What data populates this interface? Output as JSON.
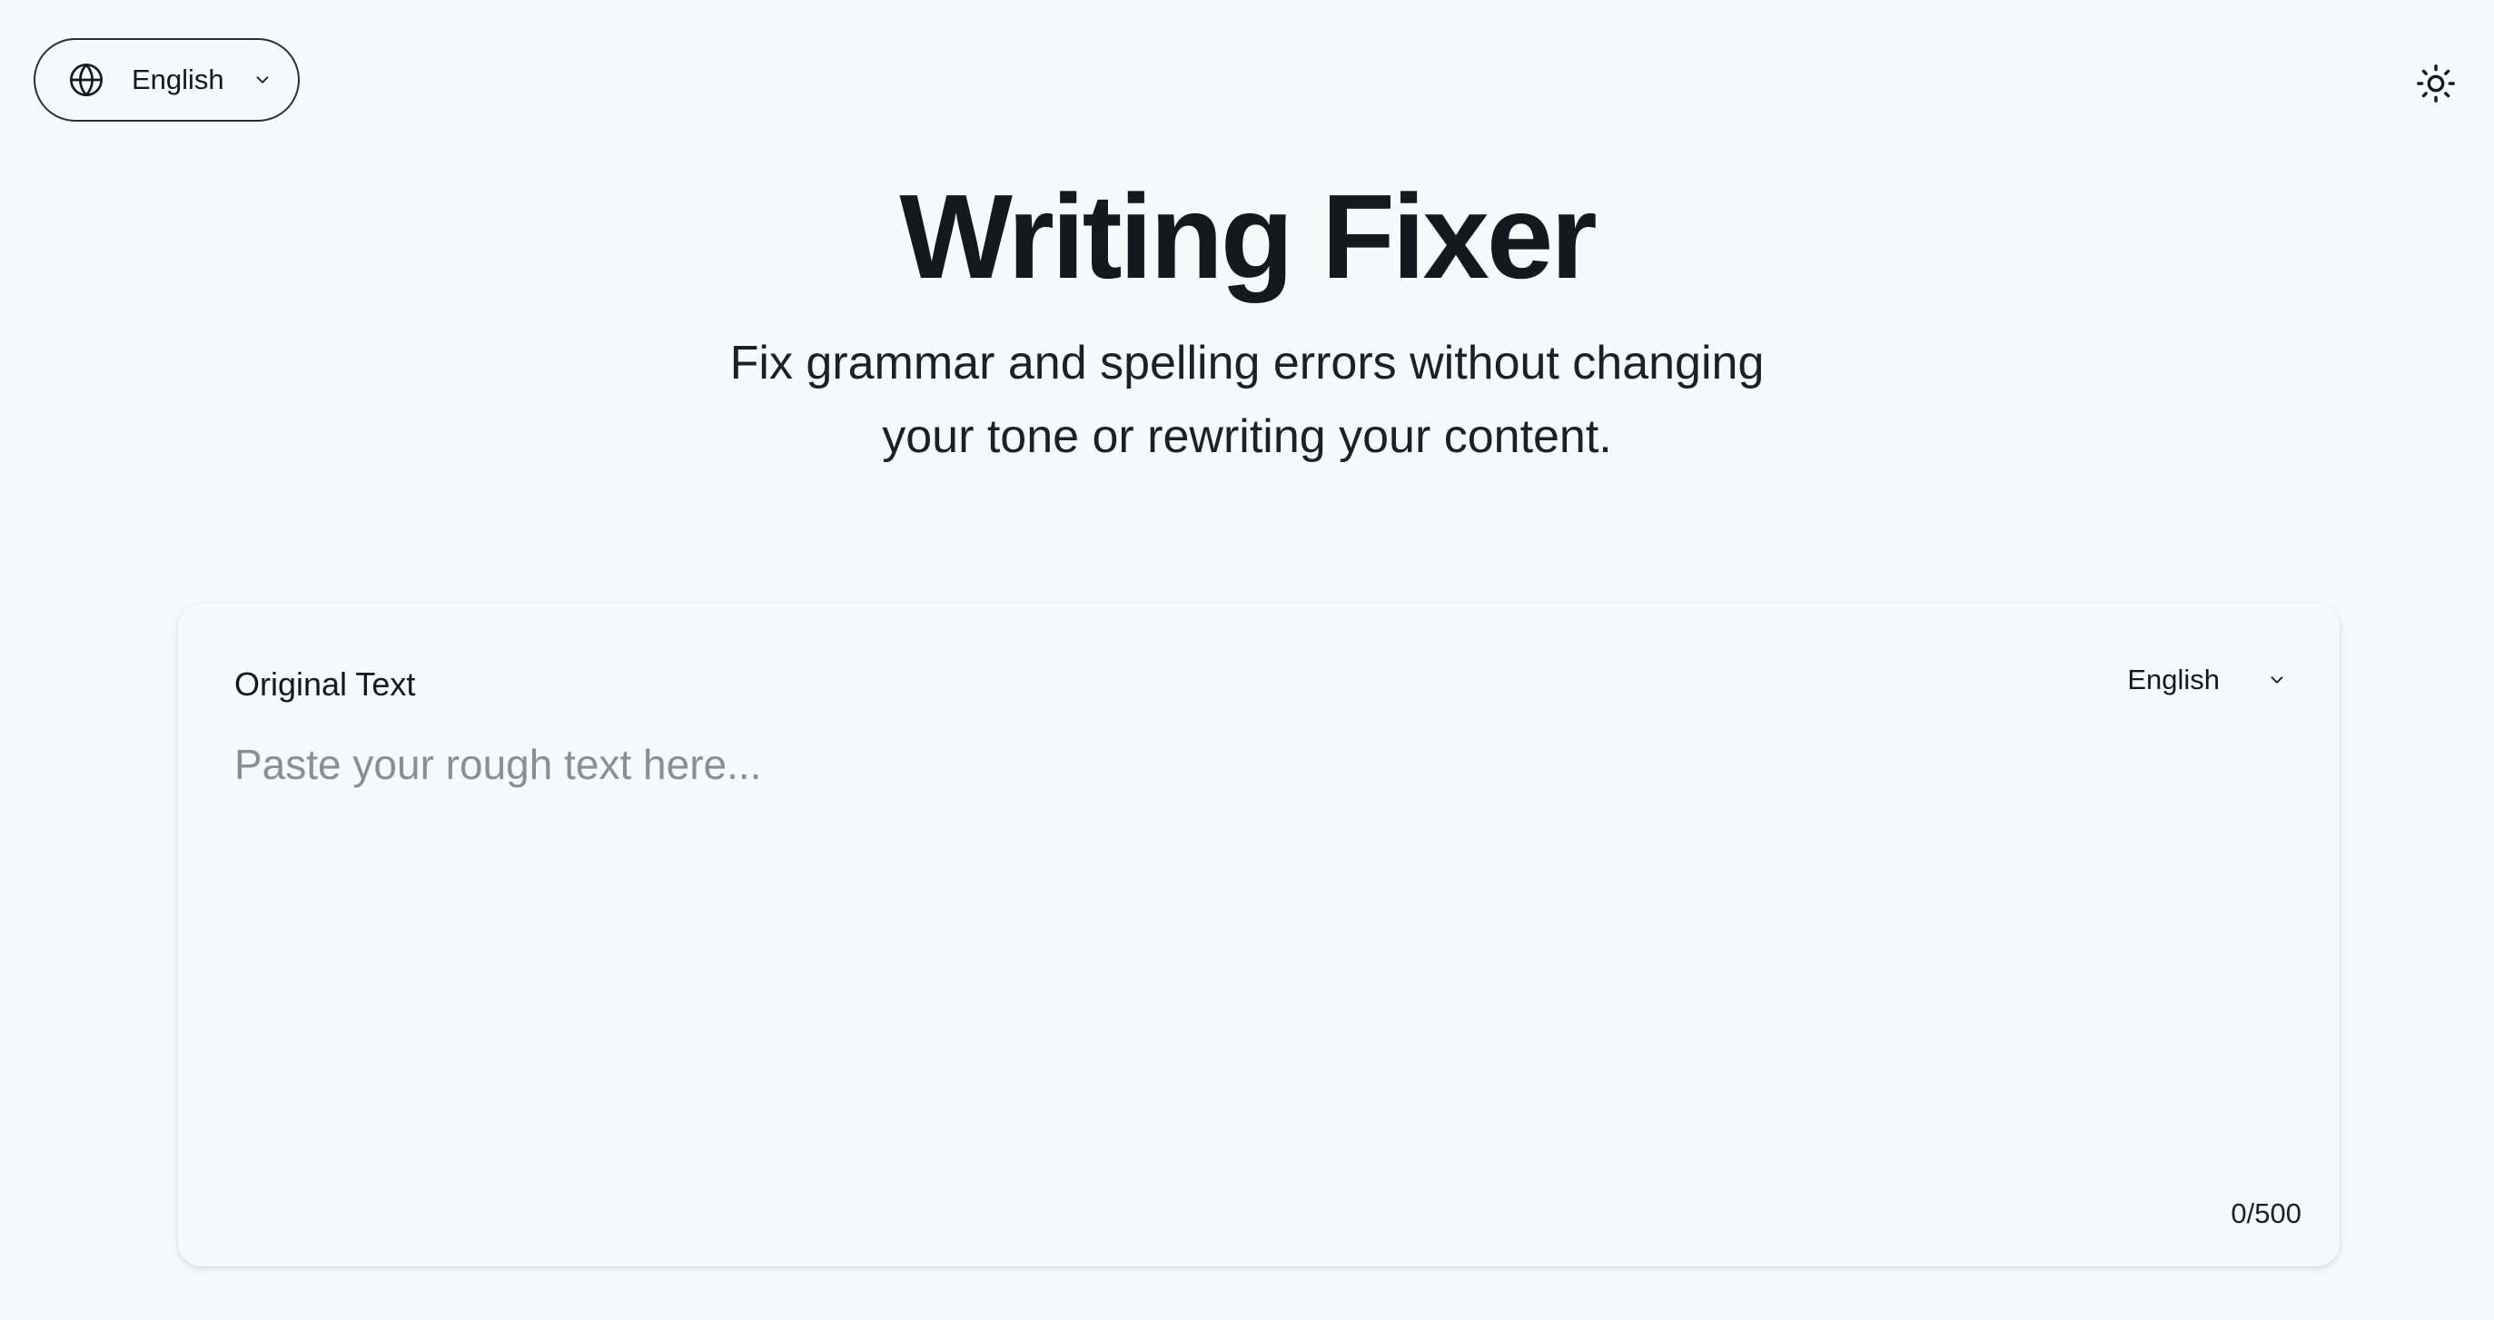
{
  "header": {
    "language_selector": {
      "icon": "globe-icon",
      "value": "English",
      "chevron_icon": "chevron-down-icon"
    },
    "theme_toggle": {
      "icon": "sun-icon"
    }
  },
  "hero": {
    "title": "Writing Fixer",
    "subtitle_line1": "Fix grammar and spelling errors without changing",
    "subtitle_line2": "your tone or rewriting your content."
  },
  "editor": {
    "label": "Original Text",
    "language_value": "English",
    "placeholder": "Paste your rough text here...",
    "value": "",
    "counter": "0/500"
  },
  "colors": {
    "background": "#f8f9fb",
    "text": "#16181d",
    "placeholder": "#8a8e96",
    "border": "#2b2e35"
  }
}
